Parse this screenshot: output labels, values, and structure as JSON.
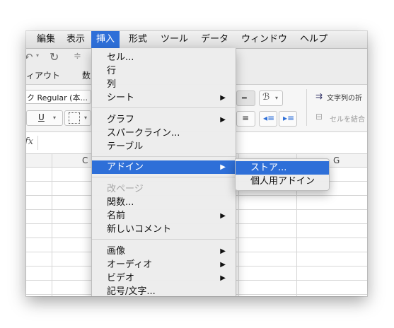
{
  "menubar": [
    "編集",
    "表示",
    "挿入",
    "形式",
    "ツール",
    "データ",
    "ウィンドウ",
    "ヘルプ"
  ],
  "ribbon": {
    "tab_partial_1": "ィアウト",
    "tab_partial_2": "数",
    "font_name": "ク Regular (本...",
    "underline": "U",
    "wrap_text": "文字列の折",
    "merge": "セルを結合",
    "fx": "fx"
  },
  "columns": {
    "c": "C",
    "g": "G"
  },
  "insert_menu": {
    "items": [
      {
        "label": "セル...",
        "submenu": false,
        "disabled": false
      },
      {
        "label": "行",
        "submenu": false,
        "disabled": false
      },
      {
        "label": "列",
        "submenu": false,
        "disabled": false
      },
      {
        "label": "シート",
        "submenu": true,
        "disabled": false
      },
      {
        "label": "グラフ",
        "submenu": true,
        "disabled": false
      },
      {
        "label": "スパークライン...",
        "submenu": false,
        "disabled": false
      },
      {
        "label": "テーブル",
        "submenu": false,
        "disabled": false
      },
      {
        "label": "アドイン",
        "submenu": true,
        "disabled": false,
        "highlighted": true
      },
      {
        "label": "改ページ",
        "submenu": false,
        "disabled": true
      },
      {
        "label": "関数...",
        "submenu": false,
        "disabled": false
      },
      {
        "label": "名前",
        "submenu": true,
        "disabled": false
      },
      {
        "label": "新しいコメント",
        "submenu": false,
        "disabled": false
      },
      {
        "label": "画像",
        "submenu": true,
        "disabled": false
      },
      {
        "label": "オーディオ",
        "submenu": true,
        "disabled": false
      },
      {
        "label": "ビデオ",
        "submenu": true,
        "disabled": false
      },
      {
        "label": "記号/文字...",
        "submenu": false,
        "disabled": false
      }
    ]
  },
  "addin_submenu": {
    "items": [
      {
        "label": "ストア...",
        "highlighted": true
      },
      {
        "label": "個人用アドイン",
        "highlighted": false
      }
    ]
  },
  "colors": {
    "accent": "#2e6fd8"
  }
}
